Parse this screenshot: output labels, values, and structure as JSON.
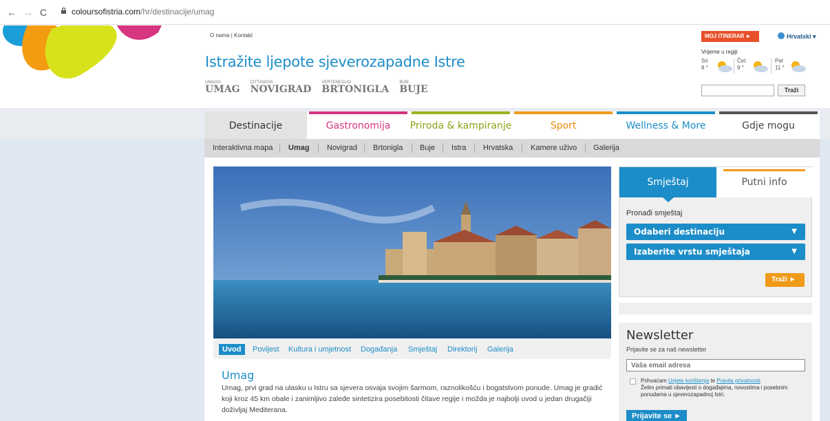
{
  "browser": {
    "nav_back": "←",
    "nav_forward": "→",
    "nav_reload": "C",
    "url_host": "coloursofistria.com",
    "url_path": "/hr/destinacije/umag"
  },
  "header": {
    "links": [
      "O nama",
      "Kontakt"
    ],
    "link_separator": "|",
    "tagline": "Istražite ljepote sjeverozapadne Istre",
    "towns": [
      {
        "small": "UMAGO",
        "big": "UMAG"
      },
      {
        "small": "CITTANOVA",
        "big": "NOVIGRAD"
      },
      {
        "small": "VERTENEGLIO",
        "big": "BRTONIGLA"
      },
      {
        "small": "BUIE",
        "big": "BUJE"
      }
    ],
    "itinerary_button": "MOJ ITINERAR ►",
    "language": "Hrvatski ▾",
    "weather_title": "Vrijeme u regiji",
    "weather": [
      {
        "day": "Sri",
        "temp": "8 °"
      },
      {
        "day": "Čet",
        "temp": "9 °"
      },
      {
        "day": "Pet",
        "temp": "11 °"
      }
    ],
    "search_value": "",
    "search_button": "Traži"
  },
  "mainnav": [
    {
      "label": "Destinacije",
      "color": "#e3e3e3"
    },
    {
      "label": "Gastronomija",
      "color": "#d6357f"
    },
    {
      "label": "Priroda & kampiranje",
      "color": "#9bb31c"
    },
    {
      "label": "Sport",
      "color": "#f09a1a"
    },
    {
      "label": "Wellness & More",
      "color": "#1c8dc8"
    },
    {
      "label": "Gdje mogu pronaći…?",
      "color": "#555555"
    }
  ],
  "subnav": [
    "Interaktivna mapa",
    "Umag",
    "Novigrad",
    "Brtonigla",
    "Buje",
    "Istra",
    "Hrvatska",
    "Kamere uživo",
    "Galerija"
  ],
  "content_tabs": [
    "Uvod",
    "Povijest",
    "Kultura i umjetnost",
    "Događanja",
    "Smještaj",
    "Direktorij",
    "Galerija"
  ],
  "article": {
    "title": "Umag",
    "text": "Umag, prvi grad na ulasku u Istru sa sjevera osvaja svojim šarmom, raznolikošću i bogatstvom ponude. Umag je gradić koji kroz 45 km obale i zanimljivo zaleđe sintetizira posebitosti čitave regije i možda je najbolji uvod u jedan drugačiji doživljaj Mediterana."
  },
  "accommodation": {
    "tab_active": "Smještaj",
    "tab_other": "Putni info",
    "label": "Pronađi smještaj",
    "select_destination": "Odaberi destinaciju",
    "select_type": "Izaberite vrstu smještaja",
    "caret": "▼",
    "submit": "Traži ►"
  },
  "newsletter": {
    "title": "Newsletter",
    "subtitle": "Prijavite se za naš newsletter",
    "placeholder": "Vaša email adresa",
    "terms_prefix": "Prihvaćam ",
    "terms_link1": "Uvjete korištenja",
    "terms_mid": " te ",
    "terms_link2": "Pravila privatnosti",
    "terms_suffix": ".",
    "terms_line2": "Želim primati obavijesti o događajima, novostima i posebnim ponudama u sjeverozapadnoj Istri.",
    "button": "Prijavite se ►"
  },
  "icons": {
    "lock": "lock-icon",
    "globe": "globe-icon",
    "weather": "partly-sunny-icon"
  }
}
